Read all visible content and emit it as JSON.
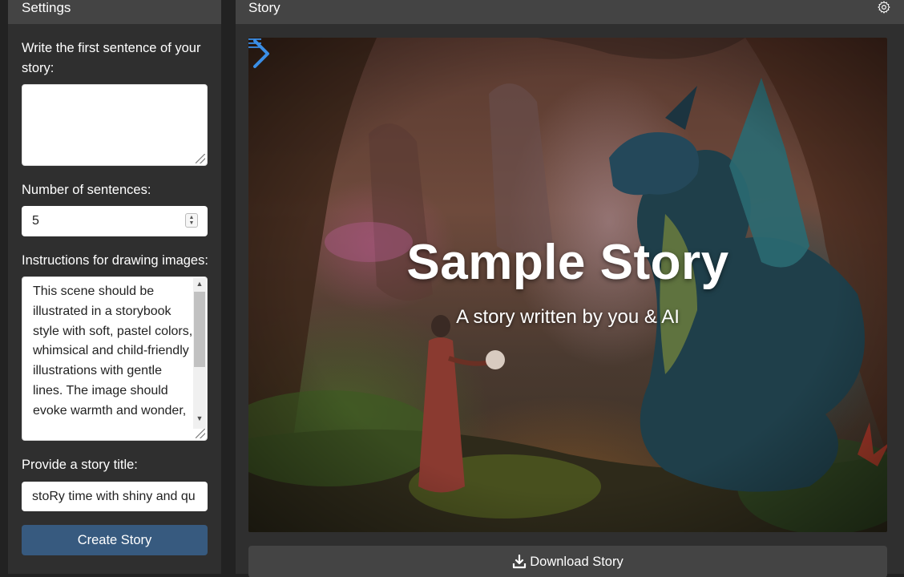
{
  "sidebar": {
    "header": "Settings",
    "first_sentence_label": "Write the first sentence of your story:",
    "first_sentence_value": "",
    "num_sentences_label": "Number of sentences:",
    "num_sentences_value": "5",
    "instructions_label": "Instructions for drawing images:",
    "instructions_value": "This scene should be illustrated in a storybook style with soft, pastel colors, whimsical and child-friendly illustrations with gentle lines. The image should evoke warmth and wonder,",
    "title_label": "Provide a story title:",
    "title_value": "stoRy time with shiny and qu",
    "create_button": "Create Story"
  },
  "main": {
    "header": "Story",
    "story_title": "Sample Story",
    "story_subtitle": "A story written by you & AI",
    "download_button": "Download Story"
  },
  "icons": {
    "settings": "gear-icon",
    "next": "chevron-right-icon",
    "menu": "hamburger-menu-icon",
    "download": "download-icon"
  },
  "colors": {
    "panel_bg": "#2f2f2f",
    "header_bg": "#444444",
    "primary_button": "#375a7f",
    "accent_arrow": "#3a8ee6"
  }
}
